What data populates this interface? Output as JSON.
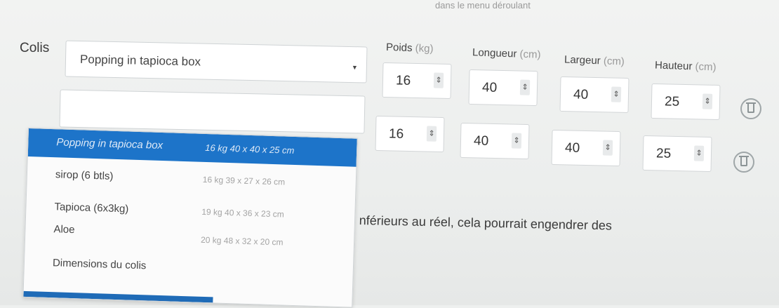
{
  "header": {
    "hint_text": "dans le menu déroulant"
  },
  "colis": {
    "label": "Colis",
    "rows": [
      {
        "package_value": "Popping in tapioca box",
        "poids": "16",
        "longueur": "40",
        "largeur": "40",
        "hauteur": "25"
      },
      {
        "package_value": "",
        "poids": "16",
        "longueur": "40",
        "largeur": "40",
        "hauteur": "25"
      }
    ]
  },
  "columns": {
    "poids": {
      "name": "Poids",
      "unit": "(kg)"
    },
    "longueur": {
      "name": "Longueur",
      "unit": "(cm)"
    },
    "largeur": {
      "name": "Largeur",
      "unit": "(cm)"
    },
    "hauteur": {
      "name": "Hauteur",
      "unit": "(cm)"
    }
  },
  "dropdown": {
    "options": [
      {
        "name": "Popping in tapioca box",
        "meta": "16 kg 40 x 40 x 25 cm",
        "selected": true
      },
      {
        "name": "sirop (6 btls)",
        "meta": "16 kg 39 x 27 x 26 cm"
      },
      {
        "name": "Tapioca (6x3kg)",
        "meta": "19 kg 40 x 36 x 23 cm"
      },
      {
        "name": "Aloe",
        "meta": "20 kg 48 x 32 x 20 cm"
      },
      {
        "name": "Dimensions du colis",
        "meta": ""
      }
    ]
  },
  "warning_text": "nférieurs au réel, cela pourrait engendrer des",
  "colors": {
    "accent": "#1d74c9",
    "background": "#eef0ef"
  },
  "icons": {
    "caret": "caret-down-icon",
    "spinner": "spinner-arrows-icon",
    "delete": "trash-icon"
  }
}
